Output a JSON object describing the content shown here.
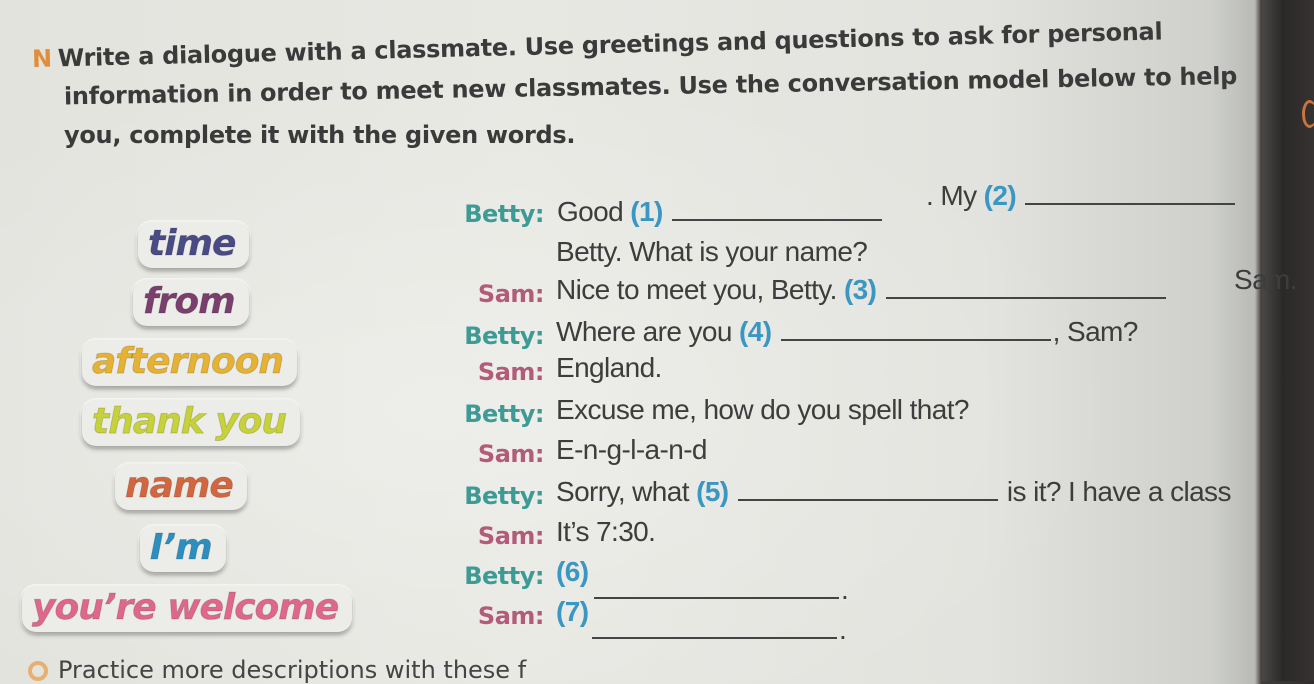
{
  "instruction": {
    "task_letter": "N",
    "lines": [
      "Write a dialogue with a classmate. Use greetings and questions to ask for personal",
      "information in order to meet new classmates. Use the conversation model below to help",
      "you, complete it with the given words."
    ]
  },
  "word_bank": [
    {
      "word": "time",
      "color": "#4a4a86"
    },
    {
      "word": "from",
      "color": "#7a3f6c"
    },
    {
      "word": "afternoon",
      "color": "#e6b234"
    },
    {
      "word": "thank you",
      "color": "#c7d13a"
    },
    {
      "word": "name",
      "color": "#d2673f"
    },
    {
      "word": "I’m",
      "color": "#2c8fc0"
    },
    {
      "word": "you’re welcome",
      "color": "#e0678c"
    }
  ],
  "dialogue": [
    {
      "speaker": "Betty:",
      "parts": [
        "Good",
        "(1)",
        ". My",
        "(2)"
      ]
    },
    {
      "speaker": "",
      "parts": [
        "Betty. What is your name?"
      ]
    },
    {
      "speaker": "Sam:",
      "parts": [
        "Nice to meet you, Betty.",
        "(3)",
        "Sam."
      ]
    },
    {
      "speaker": "Betty:",
      "parts": [
        "Where are you",
        "(4)",
        ", Sam?"
      ]
    },
    {
      "speaker": "Sam:",
      "parts": [
        "England."
      ]
    },
    {
      "speaker": "Betty:",
      "parts": [
        "Excuse me, how do you spell that?"
      ]
    },
    {
      "speaker": "Sam:",
      "parts": [
        "E-n-g-l-a-n-d"
      ]
    },
    {
      "speaker": "Betty:",
      "parts": [
        "Sorry, what",
        "(5)",
        "is it? I have a class"
      ]
    },
    {
      "speaker": "Sam:",
      "parts": [
        "It’s 7:30."
      ]
    },
    {
      "speaker": "Betty:",
      "parts": [
        "(6)",
        "."
      ]
    },
    {
      "speaker": "Sam:",
      "parts": [
        "(7)",
        "."
      ]
    }
  ],
  "footer": {
    "text": "Practice more descriptions with these f"
  },
  "colors": {
    "betty": "#3e9a94",
    "sam": "#b35b7a",
    "number": "#3a97c2",
    "task_letter": "#e08d3c"
  }
}
